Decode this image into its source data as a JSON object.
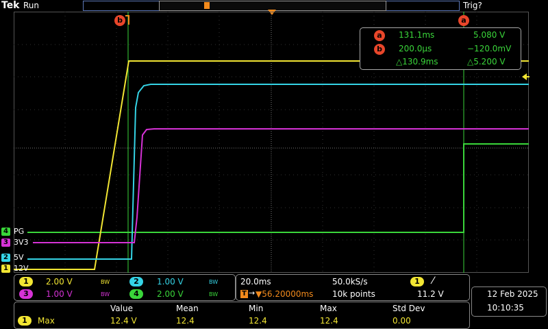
{
  "header": {
    "logo": "Tek",
    "status": "Run",
    "trigger_status": "Trig?"
  },
  "cursors": {
    "a_label": "a",
    "b_label": "b",
    "readout": {
      "a_time": "131.1ms",
      "a_volt": "5.080 V",
      "b_time": "200.0µs",
      "b_volt": "−120.0mV",
      "delta_time": "△130.9ms",
      "delta_volt": "△5.200 V"
    }
  },
  "channels": [
    {
      "num": "1",
      "name": "12V",
      "color": "#f2e633"
    },
    {
      "num": "2",
      "name": "5V",
      "color": "#35d4e6"
    },
    {
      "num": "3",
      "name": "3V3",
      "color": "#d632d6"
    },
    {
      "num": "4",
      "name": "PG",
      "color": "#3ad63a"
    }
  ],
  "vertical_settings": [
    {
      "num": "1",
      "scale": "2.00 V",
      "bw": "BW",
      "color": "#f2e633"
    },
    {
      "num": "2",
      "scale": "1.00 V",
      "bw": "BW",
      "color": "#35d4e6"
    },
    {
      "num": "3",
      "scale": "1.00 V",
      "bw": "BW",
      "color": "#d632d6"
    },
    {
      "num": "4",
      "scale": "2.00 V",
      "bw": "BW",
      "color": "#3ad63a"
    }
  ],
  "horizontal": {
    "time_per_div": "20.0ms",
    "sample_rate": "50.0kS/s",
    "trigger_position": "▼56.20000ms",
    "record_length": "10k points",
    "trigger_source": "1",
    "trigger_slope": "⁄",
    "trigger_level": "11.2 V"
  },
  "datetime": {
    "date": "12 Feb  2025",
    "time": "10:10:35"
  },
  "measurement": {
    "headers": [
      "Value",
      "Mean",
      "Min",
      "Max",
      "Std Dev"
    ],
    "channel": "1",
    "type": "Max",
    "values": [
      "12.4 V",
      "12.4",
      "12.4",
      "12.4",
      "0.00"
    ]
  }
}
